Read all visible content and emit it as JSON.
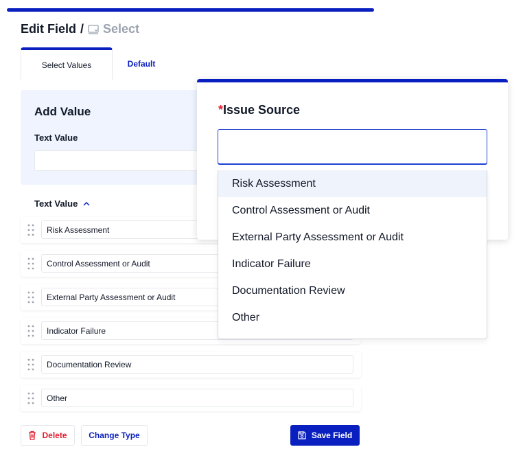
{
  "header": {
    "title": "Edit Field",
    "separator": "/",
    "crumb": "Select",
    "crumb_icon": "select-field-icon"
  },
  "tabs": [
    {
      "label": "Select Values",
      "active": true
    },
    {
      "label": "Default",
      "active": false
    }
  ],
  "add_value": {
    "heading": "Add Value",
    "field_label": "Text Value",
    "input_value": ""
  },
  "values_list": {
    "header": "Text Value",
    "sort_icon": "chevron-up-icon",
    "items": [
      "Risk Assessment",
      "Control Assessment or Audit",
      "External Party Assessment or Audit",
      "Indicator Failure",
      "Documentation Review",
      "Other"
    ]
  },
  "actions": {
    "delete_label": "Delete",
    "change_type_label": "Change Type",
    "save_label": "Save Field"
  },
  "overlay": {
    "required_marker": "*",
    "title": "Issue Source",
    "input_value": "",
    "options": [
      "Risk Assessment",
      "Control Assessment or Audit",
      "External Party Assessment or Audit",
      "Indicator Failure",
      "Documentation Review",
      "Other"
    ],
    "highlighted_option": "Risk Assessment"
  },
  "colors": {
    "accent": "#0a1fbf",
    "danger": "#e11d2e",
    "panel_bg": "#eff4ff"
  }
}
